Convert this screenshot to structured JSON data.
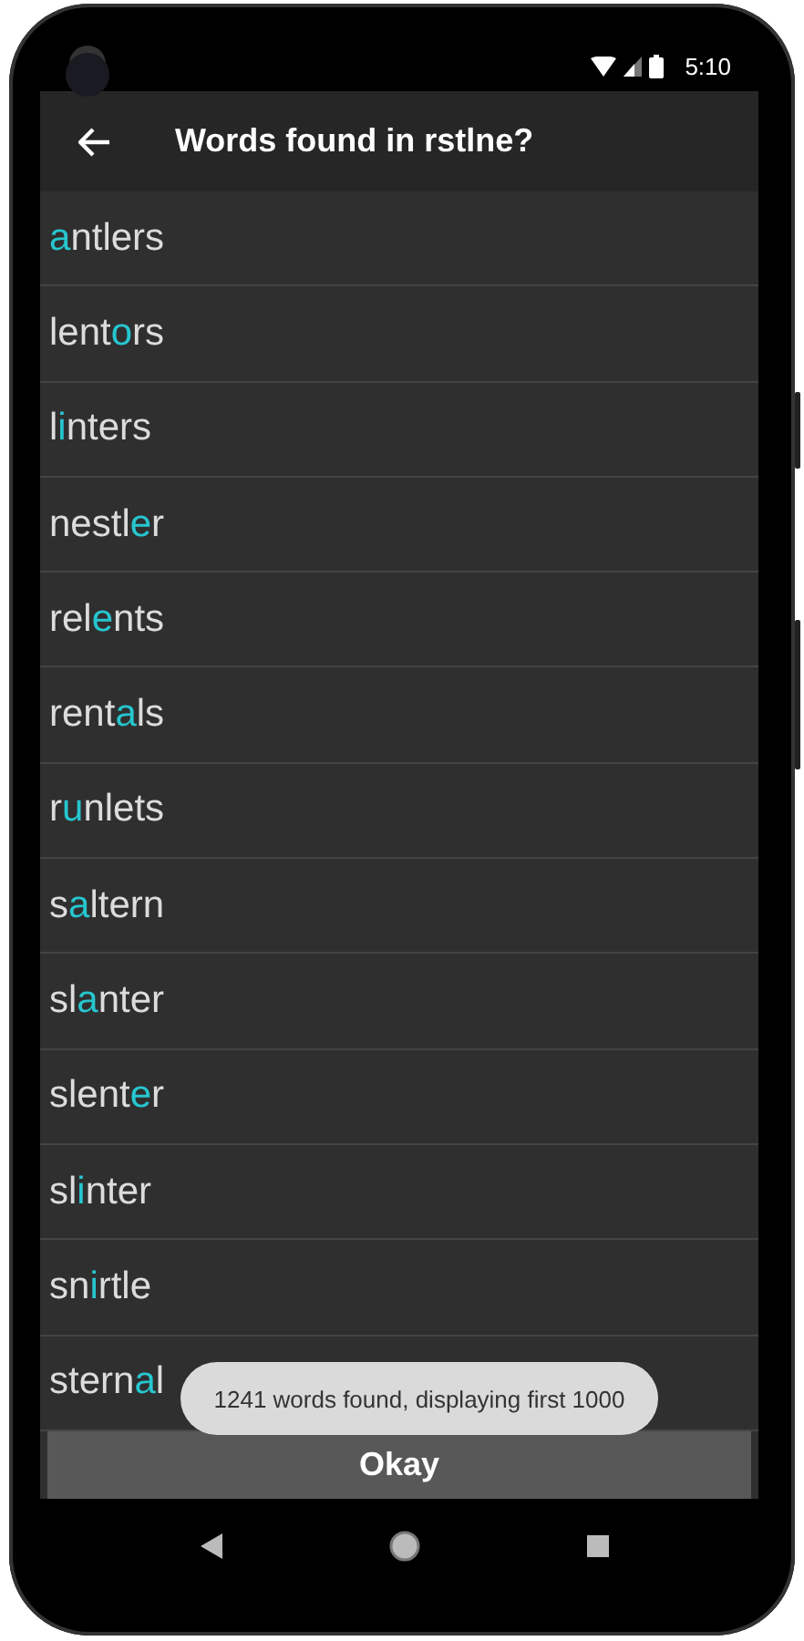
{
  "status_bar": {
    "time": "5:10"
  },
  "toolbar": {
    "title": "Words found in rstlne?"
  },
  "words": [
    {
      "mark": "a",
      "rest": "ntlers"
    },
    {
      "lead": "lent",
      "mark": "o",
      "rest": "rs"
    },
    {
      "lead": "l",
      "mark": "i",
      "rest": "nters"
    },
    {
      "lead": "nestl",
      "mark": "e",
      "rest": "r"
    },
    {
      "lead": "rel",
      "mark": "e",
      "rest": "nts"
    },
    {
      "lead": "rent",
      "mark": "a",
      "rest": "ls"
    },
    {
      "lead": "r",
      "mark": "u",
      "rest": "nlets"
    },
    {
      "lead": "s",
      "mark": "a",
      "rest": "ltern"
    },
    {
      "lead": "sl",
      "mark": "a",
      "rest": "nter"
    },
    {
      "lead": "slent",
      "mark": "e",
      "rest": "r"
    },
    {
      "lead": "sl",
      "mark": "i",
      "rest": "nter"
    },
    {
      "lead": "sn",
      "mark": "i",
      "rest": "rtle"
    },
    {
      "lead": "stern",
      "mark": "a",
      "rest": "l"
    }
  ],
  "button": {
    "label": "Okay"
  },
  "toast": {
    "text": "1241 words found, displaying first 1000"
  }
}
